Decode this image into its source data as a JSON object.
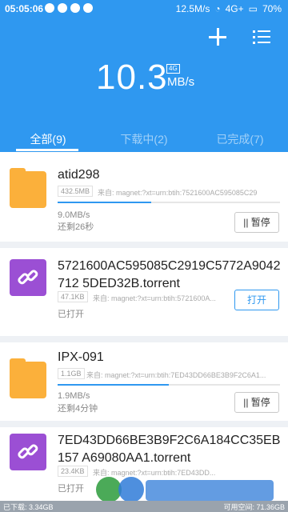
{
  "status": {
    "time": "05:05:06",
    "speed": "12.5M/s",
    "network": "4G+",
    "battery": "70%"
  },
  "header": {
    "speed_value": "10.3",
    "speed_badge": "4G",
    "speed_unit": "MB/s"
  },
  "tabs": [
    {
      "label": "全部(9)"
    },
    {
      "label": "下载中(2)"
    },
    {
      "label": "已完成(7)"
    }
  ],
  "items": [
    {
      "title": "atid298",
      "size": "432.5MB",
      "source": "来自: magnet:?xt=urn:btih:7521600AC595085C2919...",
      "progress": 0.42,
      "speed": "9.0MB/s",
      "remaining": "还剩26秒",
      "button": "|| 暂停"
    },
    {
      "title": "5721600AC595085C2919C5772A9042712 5DED32B.torrent",
      "size": "47.1KB",
      "source": "来自: magnet:?xt=urn:btih:5721600A...",
      "status": "已打开",
      "button": "打开"
    },
    {
      "title": "IPX-091",
      "size": "1.1GB",
      "source": "来自: magnet:?xt=urn:btih:7ED43DD66BE3B9F2C6A1...",
      "progress": 0.5,
      "speed": "1.9MB/s",
      "remaining": "还剩4分钟",
      "button": "|| 暂停"
    },
    {
      "title": "7ED43DD66BE3B9F2C6A184CC35EB157 A69080AA1.torrent",
      "size": "23.4KB",
      "source": "来自: magnet:?xt=urn:btih:7ED43DD...",
      "status": "已打开"
    }
  ],
  "footer": {
    "downloaded": "已下载: 3.34GB",
    "free": "可用空间: 71.36GB"
  },
  "colors": {
    "accent": "#2f98f0",
    "folder": "#fbb03b",
    "link": "#9b4fd4"
  }
}
